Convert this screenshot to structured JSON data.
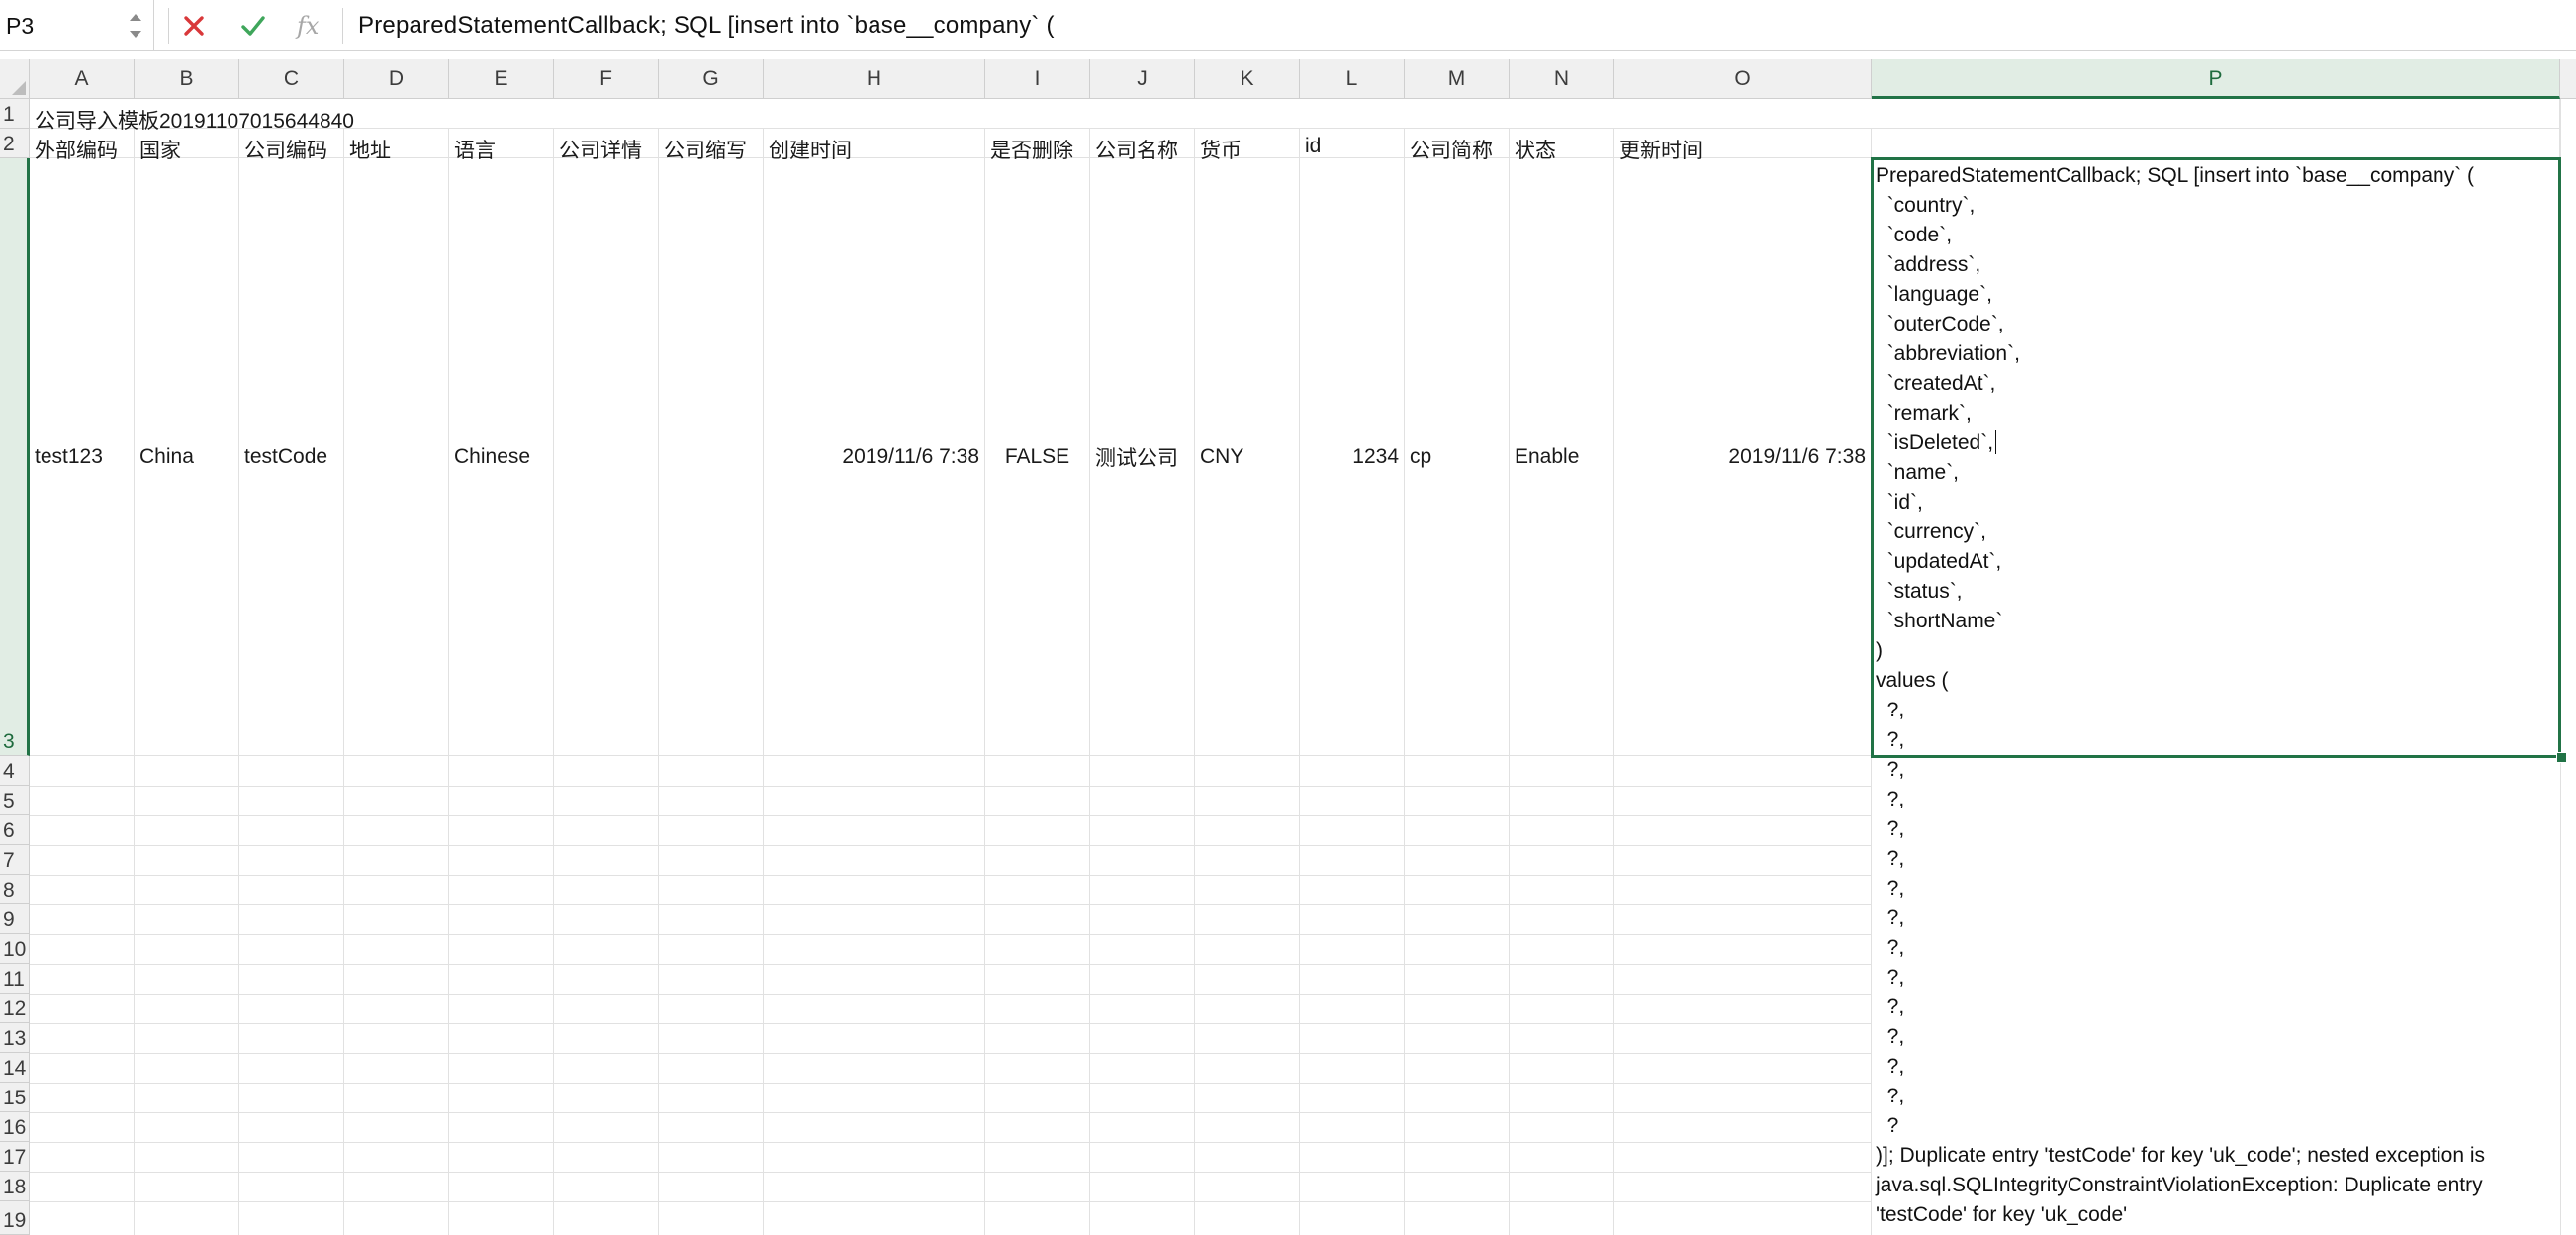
{
  "name_box": {
    "value": "P3"
  },
  "formula_bar": {
    "cancel_icon": "x-mark-icon",
    "enter_icon": "check-mark-icon",
    "fx_label": "fx",
    "content": "PreparedStatementCallback; SQL [insert into `base__company` ("
  },
  "columns": [
    "A",
    "B",
    "C",
    "D",
    "E",
    "F",
    "G",
    "H",
    "I",
    "J",
    "K",
    "L",
    "M",
    "N",
    "O",
    "P"
  ],
  "selected_column": "P",
  "rows": [
    "1",
    "2",
    "3",
    "4",
    "5",
    "6",
    "7",
    "8",
    "9",
    "10",
    "11",
    "12",
    "13",
    "14",
    "15",
    "16",
    "17",
    "18",
    "19"
  ],
  "selected_row": "3",
  "sheet": {
    "title": "公司导入模板20191107015644840",
    "headers": [
      "外部编码",
      "国家",
      "公司编码",
      "地址",
      "语言",
      "公司详情",
      "公司缩写",
      "创建时间",
      "是否删除",
      "公司名称",
      "货币",
      "id",
      "公司简称",
      "状态",
      "更新时间"
    ],
    "record": {
      "A": "test123",
      "B": "China",
      "C": "testCode",
      "D": "",
      "E": "Chinese",
      "F": "",
      "G": "",
      "H": "2019/11/6 7:38",
      "I": "FALSE",
      "J": "测试公司",
      "K": "CNY",
      "L": "1234",
      "M": "cp",
      "N": "Enable",
      "O": "2019/11/6 7:38"
    },
    "active_cell_lines": [
      "PreparedStatementCallback; SQL [insert into `base__company` (",
      "  `country`,",
      "  `code`,",
      "  `address`,",
      "  `language`,",
      "  `outerCode`,",
      "  `abbreviation`,",
      "  `createdAt`,",
      "  `remark`,",
      "  `isDeleted`,",
      "  `name`,",
      "  `id`,",
      "  `currency`,",
      "  `updatedAt`,",
      "  `status`,",
      "  `shortName`",
      ")",
      "values (",
      "  ?,",
      "  ?,",
      "  ?,",
      "  ?,",
      "  ?,",
      "  ?,",
      "  ?,",
      "  ?,",
      "  ?,",
      "  ?,",
      "  ?,",
      "  ?,",
      "  ?,",
      "  ?,",
      "  ?",
      ")]; Duplicate entry 'testCode' for key 'uk_code'; nested exception is",
      "java.sql.SQLIntegrityConstraintViolationException: Duplicate entry",
      "'testCode' for key 'uk_code'"
    ]
  },
  "colors": {
    "accent": "#217346",
    "gridline": "#e1e1e1",
    "header_bg": "#f0f0f0",
    "cancel": "#d9383a"
  }
}
